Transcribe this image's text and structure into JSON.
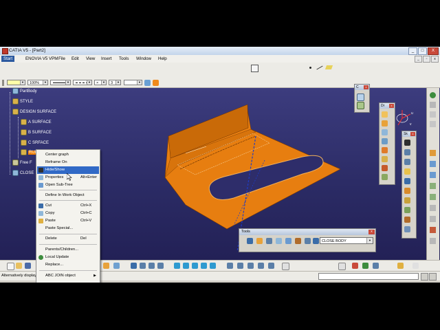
{
  "window": {
    "title": "CATIA V5 - [Part2]",
    "buttons": [
      "_",
      "□",
      "X"
    ]
  },
  "menubar": {
    "start": "Start",
    "items": [
      "ENOVIA V5 VPM",
      "File",
      "Edit",
      "View",
      "Insert",
      "Tools",
      "Window",
      "Help"
    ]
  },
  "toolbar": {
    "zoom_value": "100%",
    "point_count": "3"
  },
  "tree": {
    "items": [
      {
        "label": "PartBody"
      },
      {
        "label": "STYLE"
      },
      {
        "label": "DESIGN SURFACE"
      },
      {
        "label": "A SURFACE"
      },
      {
        "label": "B SURFACE"
      },
      {
        "label": "C SRFACE"
      },
      {
        "label": "RUL"
      },
      {
        "label": "Free F"
      },
      {
        "label": "CLOSE"
      }
    ]
  },
  "context_menu": {
    "items": [
      {
        "label": "Center graph",
        "shortcut": ""
      },
      {
        "label": "Reframe On",
        "shortcut": ""
      },
      {
        "label": "Hide/Show",
        "shortcut": ""
      },
      {
        "label": "Properties",
        "shortcut": "Alt+Enter"
      },
      {
        "label": "Open Sub-Tree",
        "shortcut": ""
      },
      {
        "label": "Define In Work Object",
        "shortcut": ""
      },
      {
        "label": "Cut",
        "shortcut": "Ctrl+X"
      },
      {
        "label": "Copy",
        "shortcut": "Ctrl+C"
      },
      {
        "label": "Paste",
        "shortcut": "Ctrl+V"
      },
      {
        "label": "Paste Special...",
        "shortcut": ""
      },
      {
        "label": "Delete",
        "shortcut": "Del"
      },
      {
        "label": "Parents/Children...",
        "shortcut": ""
      },
      {
        "label": "Local Update",
        "shortcut": ""
      },
      {
        "label": "Replace...",
        "shortcut": ""
      },
      {
        "label": "ABC JOIN object",
        "shortcut": ""
      }
    ]
  },
  "tools_panel": {
    "title": "Tools",
    "combo_value": "CLOSE BODY"
  },
  "side_panels": {
    "panel_a": "C",
    "panel_b": "Dr",
    "panel_c": "Sk"
  },
  "status": {
    "text": "Alternatively display"
  },
  "compass": {
    "labels": [
      "u",
      "v"
    ]
  },
  "colors": {
    "viewport": "#2e2d6a",
    "part": "#f07d00",
    "highlight": "#3169c6"
  }
}
